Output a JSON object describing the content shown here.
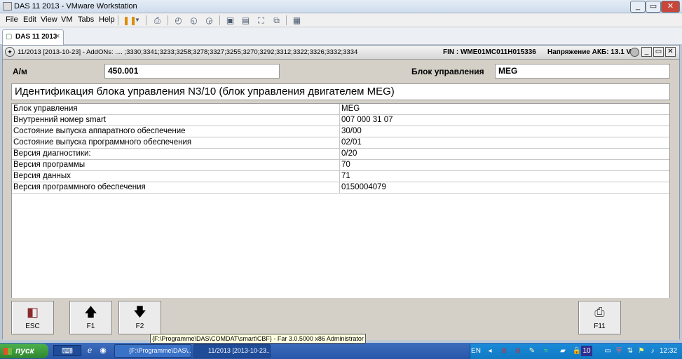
{
  "window": {
    "title": "DAS 11 2013 - VMware Workstation",
    "controls": {
      "minimize": "_",
      "restore": "▭",
      "close": "✕"
    }
  },
  "menu": [
    "File",
    "Edit",
    "View",
    "VM",
    "Tabs",
    "Help"
  ],
  "toolbar": {
    "icons": [
      "pause-icon",
      "dropdown-chevron-icon",
      "send-ctrl-alt-del-icon",
      "snapshot-icon",
      "snapshot-revert-icon",
      "snapshot-manager-icon",
      "sidebar-view-icon",
      "console-view-icon",
      "fullscreen-icon",
      "unity-icon",
      "thumbnail-view-icon"
    ]
  },
  "tab": {
    "label": "DAS 11 2013",
    "close": "×"
  },
  "das": {
    "header": {
      "version_info": "11/2013 [2013-10-23] - AddONs:  .... ;3330;3341;3233;3258;3278;3327;3255;3270;3292;3312;3322;3326;3332;3334",
      "fin": "FIN : WME01MC011H015336",
      "battery": "Напряжение АКБ: 13.1 V",
      "controls": {
        "minimize": "_",
        "restore": "▭",
        "close": "✕"
      }
    },
    "vehicle_label": "А/м",
    "vehicle_value": "450.001",
    "control_unit_label": "Блок управления",
    "control_unit_value": "MEG",
    "heading": "Идентификация блока управления N3/10 (блок управления двигателем MEG)",
    "rows": [
      {
        "name": "Блок управления",
        "value": "MEG"
      },
      {
        "name": "Внутренний номер smart",
        "value": "007 000 31 07"
      },
      {
        "name": "Состояние выпуска аппаратного обеспечение",
        "value": "30/00"
      },
      {
        "name": "Состояние выпуска программного обеспечения",
        "value": "02/01"
      },
      {
        "name": "Версия диагностики:",
        "value": "0/20"
      },
      {
        "name": "Версия программы",
        "value": "70"
      },
      {
        "name": "Версия данных",
        "value": "71"
      },
      {
        "name": "Версия программного обеспечения",
        "value": "0150004079"
      }
    ],
    "buttons": {
      "esc": "ESC",
      "f1": "F1",
      "f2": "F2",
      "f11": "F11"
    }
  },
  "tooltip": "{F:\\Programme\\DAS\\COMDAT\\smart\\CBF} - Far 3.0.5000 x86 Administrator",
  "taskbar": {
    "start": "пуск",
    "tasks": [
      "{F:\\Programme\\DAS\\...",
      "11/2013 [2013-10-23..."
    ],
    "lang": "EN",
    "tray_counter": "10",
    "clock": "12:32"
  },
  "colors": {
    "taskbar": "#2856a8",
    "start_button": "#3a9a3a",
    "das_background": "#d4d0c8"
  }
}
